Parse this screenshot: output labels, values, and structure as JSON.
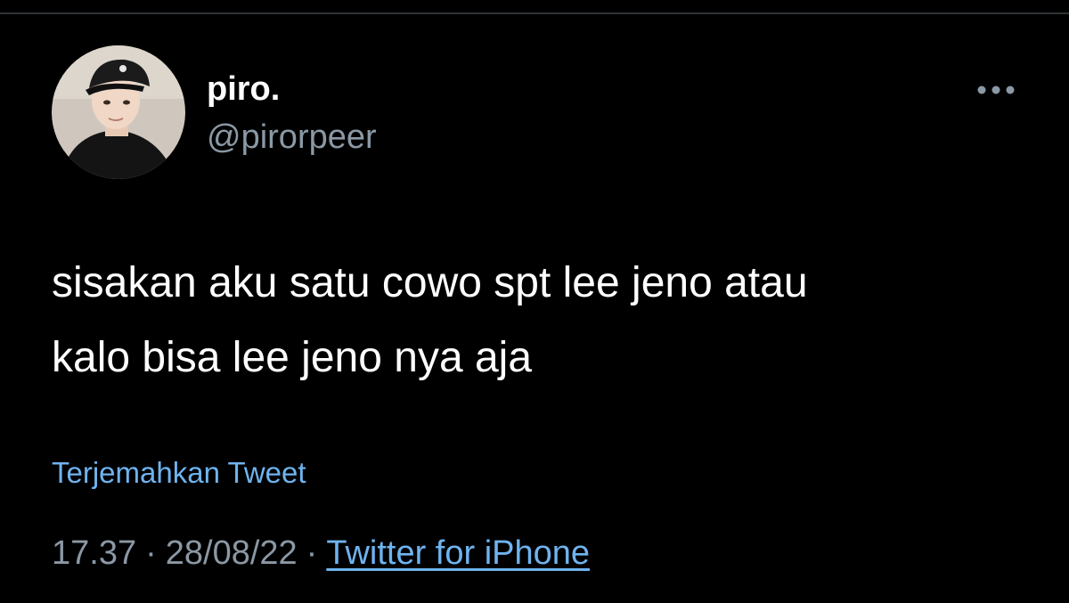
{
  "user": {
    "display_name": "piro.",
    "handle": "@pirorpeer"
  },
  "tweet": {
    "text_lines": [
      "sisakan aku satu cowo spt lee jeno atau",
      "kalo bisa lee jeno nya aja"
    ],
    "translate_label": "Terjemahkan Tweet",
    "time": "17.37",
    "date": "28/08/22",
    "separator": "·",
    "source": "Twitter for iPhone"
  },
  "icons": {
    "more": "more-horizontal-icon",
    "avatar": "profile-photo"
  },
  "colors": {
    "background": "#000000",
    "text_primary": "#ffffff",
    "text_secondary": "#8b98a5",
    "link": "#6fb3ef",
    "divider": "#2f3336"
  }
}
